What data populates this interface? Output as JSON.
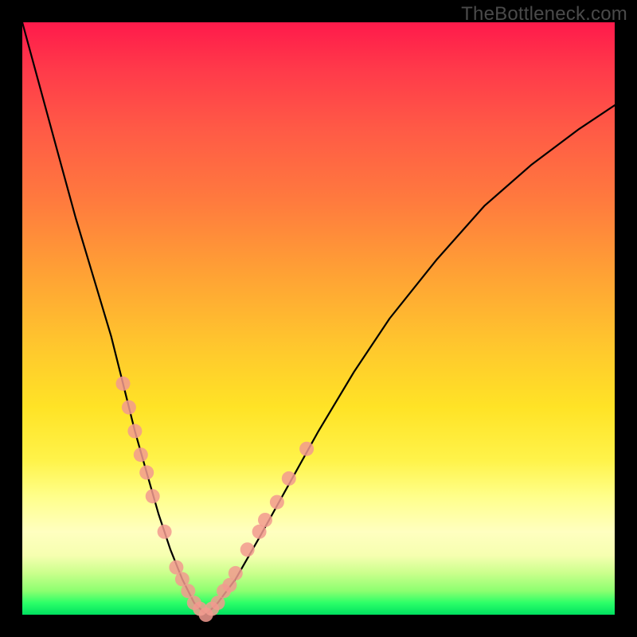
{
  "watermark": "TheBottleneck.com",
  "chart_data": {
    "type": "line",
    "title": "",
    "xlabel": "",
    "ylabel": "",
    "xlim": [
      0,
      100
    ],
    "ylim": [
      0,
      100
    ],
    "series": [
      {
        "name": "bottleneck-curve",
        "x": [
          0,
          3,
          6,
          9,
          12,
          15,
          17,
          19,
          21,
          23,
          25,
          27,
          29,
          31,
          33,
          36,
          40,
          45,
          50,
          56,
          62,
          70,
          78,
          86,
          94,
          100
        ],
        "values": [
          100,
          89,
          78,
          67,
          57,
          47,
          39,
          31,
          24,
          17,
          11,
          6,
          2,
          0,
          2,
          6,
          13,
          22,
          31,
          41,
          50,
          60,
          69,
          76,
          82,
          86
        ]
      }
    ],
    "markers": {
      "name": "highlighted-points",
      "color": "#f29a8f",
      "points": [
        {
          "x": 17,
          "y": 39
        },
        {
          "x": 18,
          "y": 35
        },
        {
          "x": 19,
          "y": 31
        },
        {
          "x": 20,
          "y": 27
        },
        {
          "x": 21,
          "y": 24
        },
        {
          "x": 22,
          "y": 20
        },
        {
          "x": 24,
          "y": 14
        },
        {
          "x": 26,
          "y": 8
        },
        {
          "x": 27,
          "y": 6
        },
        {
          "x": 28,
          "y": 4
        },
        {
          "x": 29,
          "y": 2
        },
        {
          "x": 30,
          "y": 1
        },
        {
          "x": 31,
          "y": 0
        },
        {
          "x": 32,
          "y": 1
        },
        {
          "x": 33,
          "y": 2
        },
        {
          "x": 34,
          "y": 4
        },
        {
          "x": 35,
          "y": 5
        },
        {
          "x": 36,
          "y": 7
        },
        {
          "x": 38,
          "y": 11
        },
        {
          "x": 40,
          "y": 14
        },
        {
          "x": 41,
          "y": 16
        },
        {
          "x": 43,
          "y": 19
        },
        {
          "x": 45,
          "y": 23
        },
        {
          "x": 48,
          "y": 28
        }
      ]
    }
  }
}
